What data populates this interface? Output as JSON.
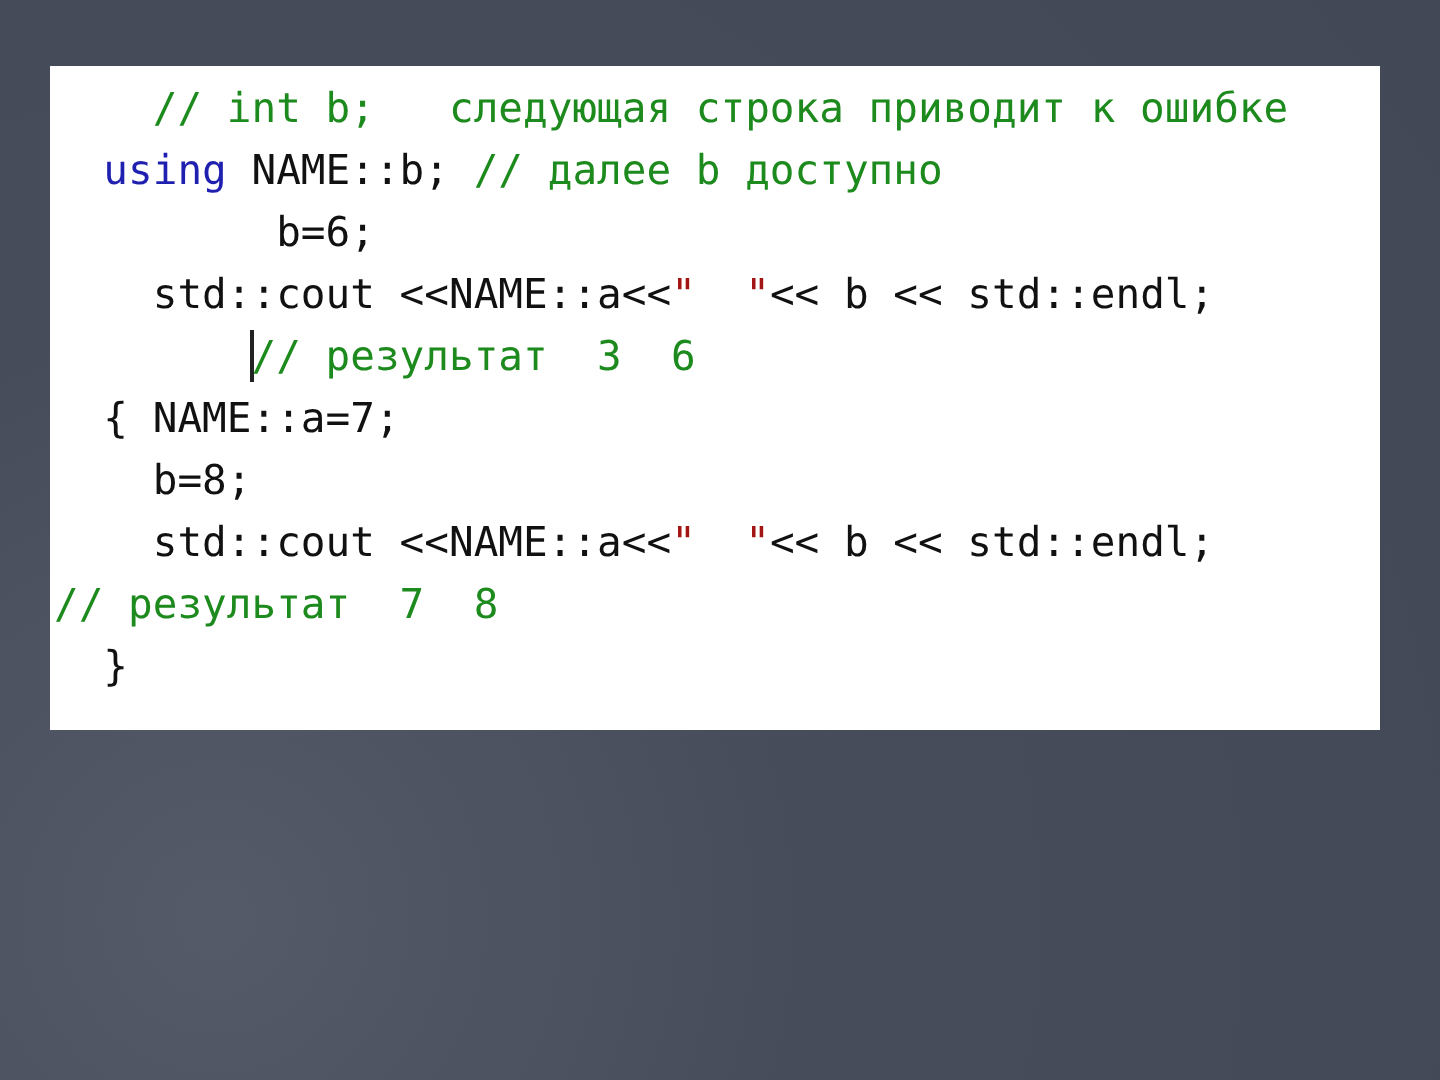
{
  "code_panel": {
    "lines": [
      {
        "caret": false,
        "tokens": [
          {
            "kind": "comment",
            "text": "    // int b;   следующая строка приводит к ошибке"
          }
        ]
      },
      {
        "caret": false,
        "tokens": [
          {
            "kind": "keyword",
            "text": "  using"
          },
          {
            "kind": "plain",
            "text": " NAME::b; "
          },
          {
            "kind": "comment",
            "text": "// далее b доступно"
          }
        ]
      },
      {
        "caret": false,
        "tokens": [
          {
            "kind": "plain",
            "text": "         b=6;"
          }
        ]
      },
      {
        "caret": false,
        "tokens": [
          {
            "kind": "plain",
            "text": "    std::cout <<NAME::a<<"
          },
          {
            "kind": "string",
            "text": "\"  \""
          },
          {
            "kind": "plain",
            "text": "<< b << std::endl;"
          }
        ]
      },
      {
        "caret": true,
        "tokens": [
          {
            "kind": "comment",
            "text": "        // результат  3  6"
          }
        ]
      },
      {
        "caret": false,
        "tokens": [
          {
            "kind": "plain",
            "text": "  { NAME::a=7;"
          }
        ]
      },
      {
        "caret": false,
        "tokens": [
          {
            "kind": "plain",
            "text": "    b=8;"
          }
        ]
      },
      {
        "caret": false,
        "tokens": [
          {
            "kind": "plain",
            "text": "    std::cout <<NAME::a<<"
          },
          {
            "kind": "string",
            "text": "\"  \""
          },
          {
            "kind": "plain",
            "text": "<< b << std::endl;"
          }
        ]
      },
      {
        "caret": false,
        "tokens": [
          {
            "kind": "comment",
            "text": "// результат  7  8"
          }
        ]
      },
      {
        "caret": false,
        "tokens": [
          {
            "kind": "plain",
            "text": "  }"
          }
        ]
      }
    ]
  }
}
